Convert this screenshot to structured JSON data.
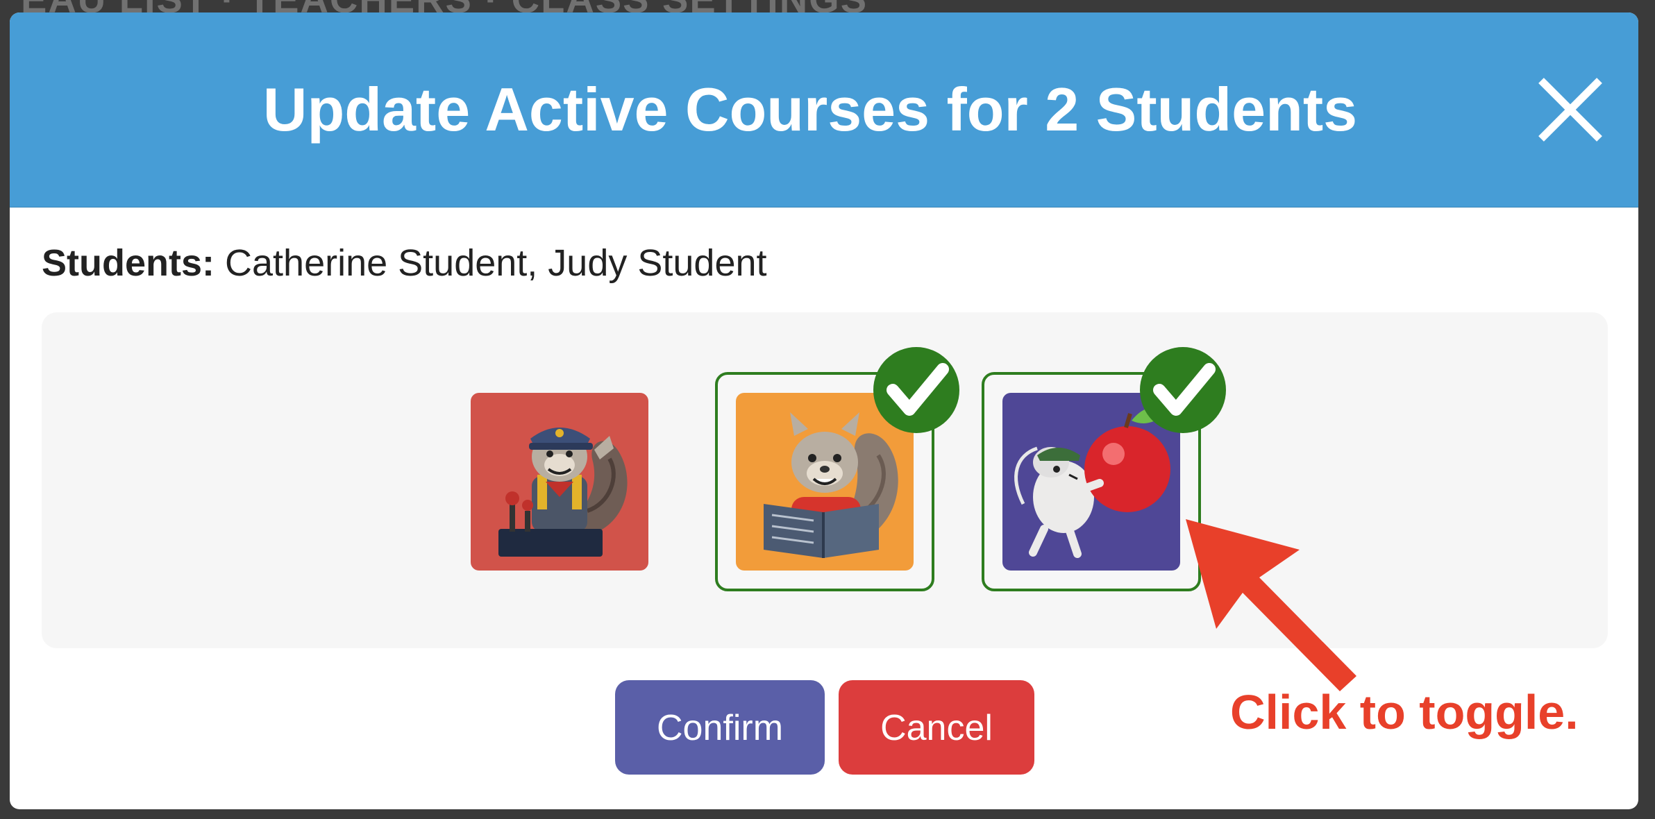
{
  "background": {
    "partial_text": "EAU LIST · TEACHERS · CLASS SETTINGS"
  },
  "dialog": {
    "title": "Update Active Courses for 2 Students",
    "close_icon": "close-icon",
    "students_label": "Students:",
    "students_value": " Catherine Student, Judy Student",
    "courses": [
      {
        "name": "conductor-squirrel",
        "icon": "squirrel-conductor-icon",
        "selected": false,
        "color": "#d1534a"
      },
      {
        "name": "reading-squirrel",
        "icon": "squirrel-reading-icon",
        "selected": true,
        "color": "#f29c3a"
      },
      {
        "name": "mouse-with-apple",
        "icon": "mouse-apple-icon",
        "selected": true,
        "color": "#4f4796"
      }
    ],
    "confirm_label": "Confirm",
    "cancel_label": "Cancel"
  },
  "annotation": {
    "text": "Click to toggle."
  },
  "colors": {
    "header": "#479dd6",
    "confirm": "#5a5fa8",
    "cancel": "#dc3d3d",
    "check": "#2e7d1f",
    "annotation": "#e8402a"
  }
}
